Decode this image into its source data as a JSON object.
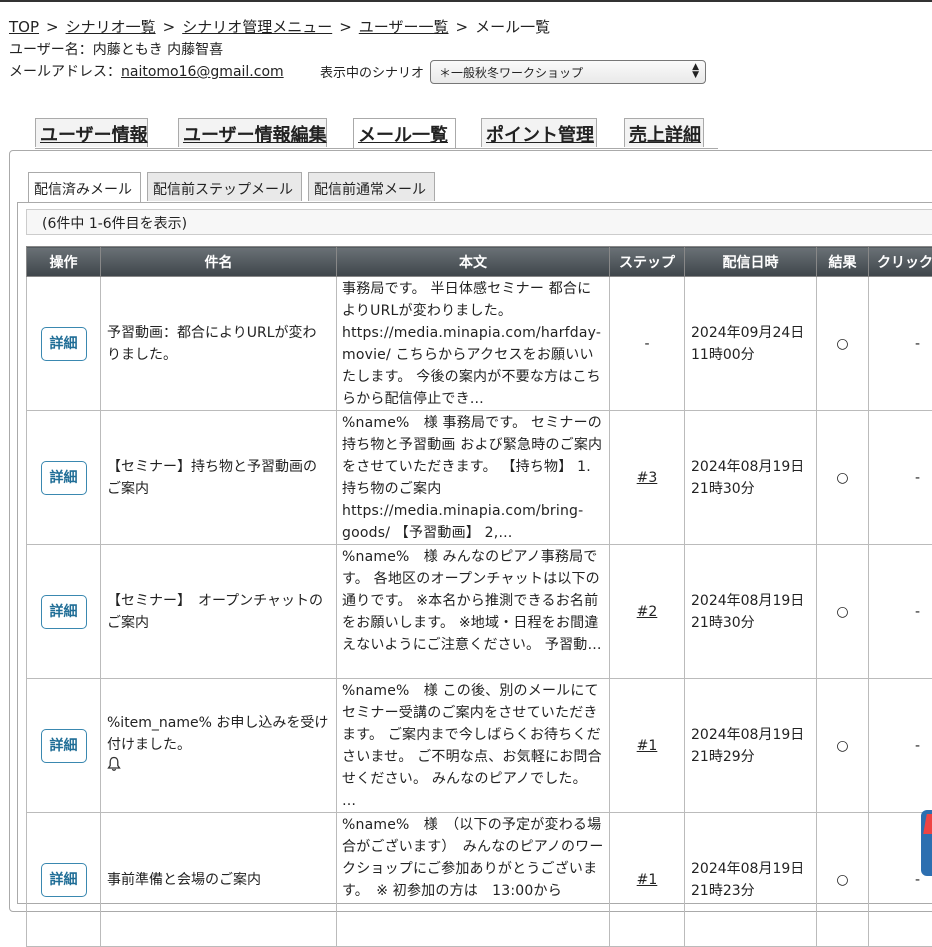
{
  "breadcrumb": {
    "items": [
      "TOP",
      "シナリオ一覧",
      "シナリオ管理メニュー",
      "ユーザー一覧",
      "メール一覧"
    ],
    "separator": ">"
  },
  "user": {
    "name_label": "ユーザー名：",
    "name_value": "内藤ともき 内藤智喜",
    "email_label": "メールアドレス：",
    "email_value": "naitomo16@gmail.com"
  },
  "scenario": {
    "label": "表示中のシナリオ",
    "selected": "＊一般秋冬ワークショップ"
  },
  "main_tabs": [
    {
      "label": "ユーザー情報",
      "active": false
    },
    {
      "label": "ユーザー情報編集",
      "active": false
    },
    {
      "label": "メール一覧",
      "active": true
    },
    {
      "label": "ポイント管理",
      "active": false
    },
    {
      "label": "売上詳細",
      "active": false
    }
  ],
  "sub_tabs": [
    {
      "label": "配信済みメール",
      "active": true
    },
    {
      "label": "配信前ステップメール",
      "active": false
    },
    {
      "label": "配信前通常メール",
      "active": false
    }
  ],
  "count_text": "(6件中 1-6件目を表示)",
  "table": {
    "headers": [
      "操作",
      "件名",
      "本文",
      "ステップ",
      "配信日時",
      "結果",
      "クリック"
    ],
    "detail_label": "詳細",
    "rows": [
      {
        "subject": "予習動画：都合によりURLが変わりました。",
        "body": "事務局です。 半日体感セミナー 都合によりURLが変わりました。 https://media.minapia.com/harfday-movie/ こちらからアクセスをお願いいたします。 今後の案内が不要な方はこちらから配信停止でき…",
        "step": "-",
        "date": "2024年09月24日",
        "time": "11時00分",
        "result": "○",
        "click": "-"
      },
      {
        "subject": "【セミナー】持ち物と予習動画のご案内",
        "body": "%name%　様 事務局です。 セミナーの持ち物と予習動画 および緊急時のご案内をさせていただきます。 【持ち物】 1.持ち物のご案内 https://media.minapia.com/bring-goods/ 【予習動画】 2,…",
        "step": "#3",
        "date": "2024年08月19日",
        "time": "21時30分",
        "result": "○",
        "click": "-"
      },
      {
        "subject": "【セミナー】　オープンチャットのご案内",
        "body": "%name%　様 みんなのピアノ事務局です。 各地区のオープンチャットは以下の通りです。 ※本名から推測できるお名前をお願いします。 ※地域・日程をお間違えないようにご注意ください。 予習動…",
        "step": "#2",
        "date": "2024年08月19日",
        "time": "21時30分",
        "result": "○",
        "click": "-"
      },
      {
        "subject": "%item_name% お申し込みを受け付けました。",
        "body": "%name%　様 この後、別のメールにてセミナー受講のご案内をさせていただきます。 ご案内まで今しばらくお待ちくださいませ。 ご不明な点、お気軽にお問合せください。 みんなのピアノでした。 …",
        "step": "#1",
        "date": "2024年08月19日",
        "time": "21時29分",
        "result": "○",
        "click": "-",
        "icon": "bell-icon"
      },
      {
        "subject": "事前準備と会場のご案内",
        "body": "%name%　様　（以下の予定が変わる場合がございます）　みんなのピアノのワークショップにご参加ありがとうございます。　※ 初参加の方は　13:00から",
        "step": "#1",
        "date": "2024年08月19日",
        "time": "21時23分",
        "result": "○",
        "click": "-"
      }
    ]
  },
  "colors": {
    "header_bg": "#4a5156",
    "detail_button": "#1f6d96"
  }
}
